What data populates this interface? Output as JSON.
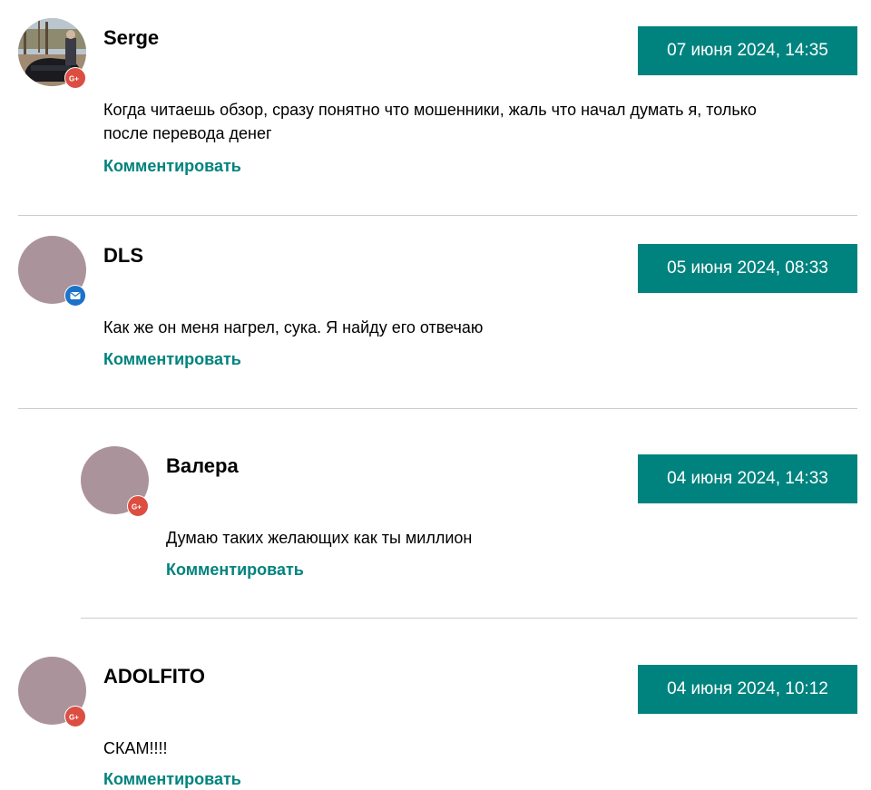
{
  "comments": [
    {
      "author": "Serge",
      "date": "07 июня 2024, 14:35",
      "text": "Когда читаешь обзор, сразу понятно что мошенники, жаль что начал думать я, только после перевода денег",
      "reply_label": "Комментировать",
      "badge": "google-plus-icon"
    },
    {
      "author": "DLS",
      "date": "05 июня 2024, 08:33",
      "text": "Как же он меня нагрел, сука. Я найду его отвечаю",
      "reply_label": "Комментировать",
      "badge": "mail-icon"
    },
    {
      "author": "Валера",
      "date": "04 июня 2024, 14:33",
      "text": "Думаю таких желающих как ты миллион",
      "reply_label": "Комментировать",
      "badge": "google-plus-icon"
    },
    {
      "author": "ADOLFITO",
      "date": "04 июня 2024, 10:12",
      "text": "СКАМ!!!!",
      "reply_label": "Комментировать",
      "badge": "google-plus-icon"
    }
  ],
  "colors": {
    "accent": "#00837e",
    "avatar_placeholder": "#ab939c",
    "google_plus": "#dc4e41",
    "mail": "#1a73c8",
    "divider": "#cccccc"
  }
}
